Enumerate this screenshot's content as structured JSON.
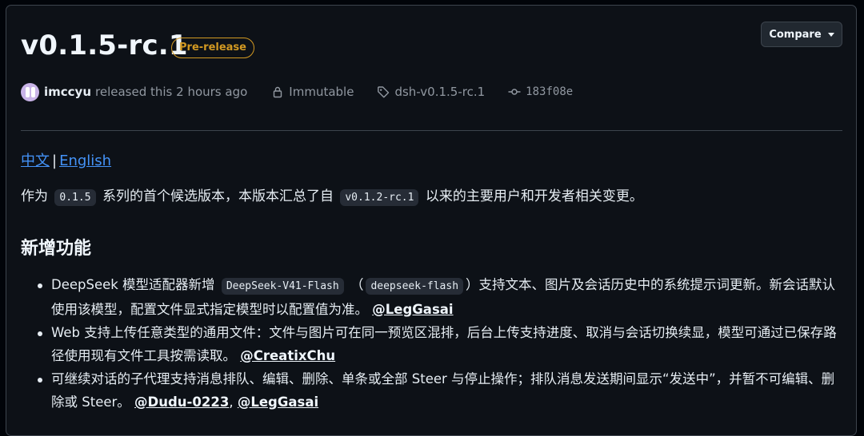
{
  "release": {
    "title": "v0.1.5-rc.1",
    "badge": "Pre-release",
    "compare_label": "Compare"
  },
  "meta": {
    "author": "imccyu",
    "released_text": "released this 2 hours ago",
    "immutable": "Immutable",
    "tag": "dsh-v0.1.5-rc.1",
    "commit": "183f08e"
  },
  "langs": {
    "zh": "中文",
    "sep": "|",
    "en": "English"
  },
  "intro": {
    "p1": "作为",
    "code1": "0.1.5",
    "p2": "系列的首个候选版本，本版本汇总了自",
    "code2": "v0.1.2-rc.1",
    "p3": "以来的主要用户和开发者相关变更。"
  },
  "section_title": "新增功能",
  "items": [
    {
      "t1": "DeepSeek 模型适配器新增",
      "code1": "DeepSeek-V41-Flash",
      "t2": "（",
      "code2": "deepseek-flash",
      "t3": "）支持文本、图片及会话历史中的系统提示词更新。新会话默认使用该模型，配置文件显式指定模型时以配置值为准。",
      "mention1": "@LegGasai"
    },
    {
      "t1": "Web 支持上传任意类型的通用文件：文件与图片可在同一预览区混排，后台上传支持进度、取消与会话切换续显，模型可通过已保存路径使用现有文件工具按需读取。",
      "mention1": "@CreatixChu"
    },
    {
      "t1": "可继续对话的子代理支持消息排队、编辑、删除、单条或全部 Steer 与停止操作；排队消息发送期间显示“发送中”，并暂不可编辑、删除或 Steer。",
      "mention1": "@Dudu-0223",
      "sep": ",",
      "mention2": "@LegGasai"
    }
  ],
  "colors": {
    "accent": "#4493f8",
    "prerelease": "#d29922",
    "bg": "#0d1117"
  }
}
